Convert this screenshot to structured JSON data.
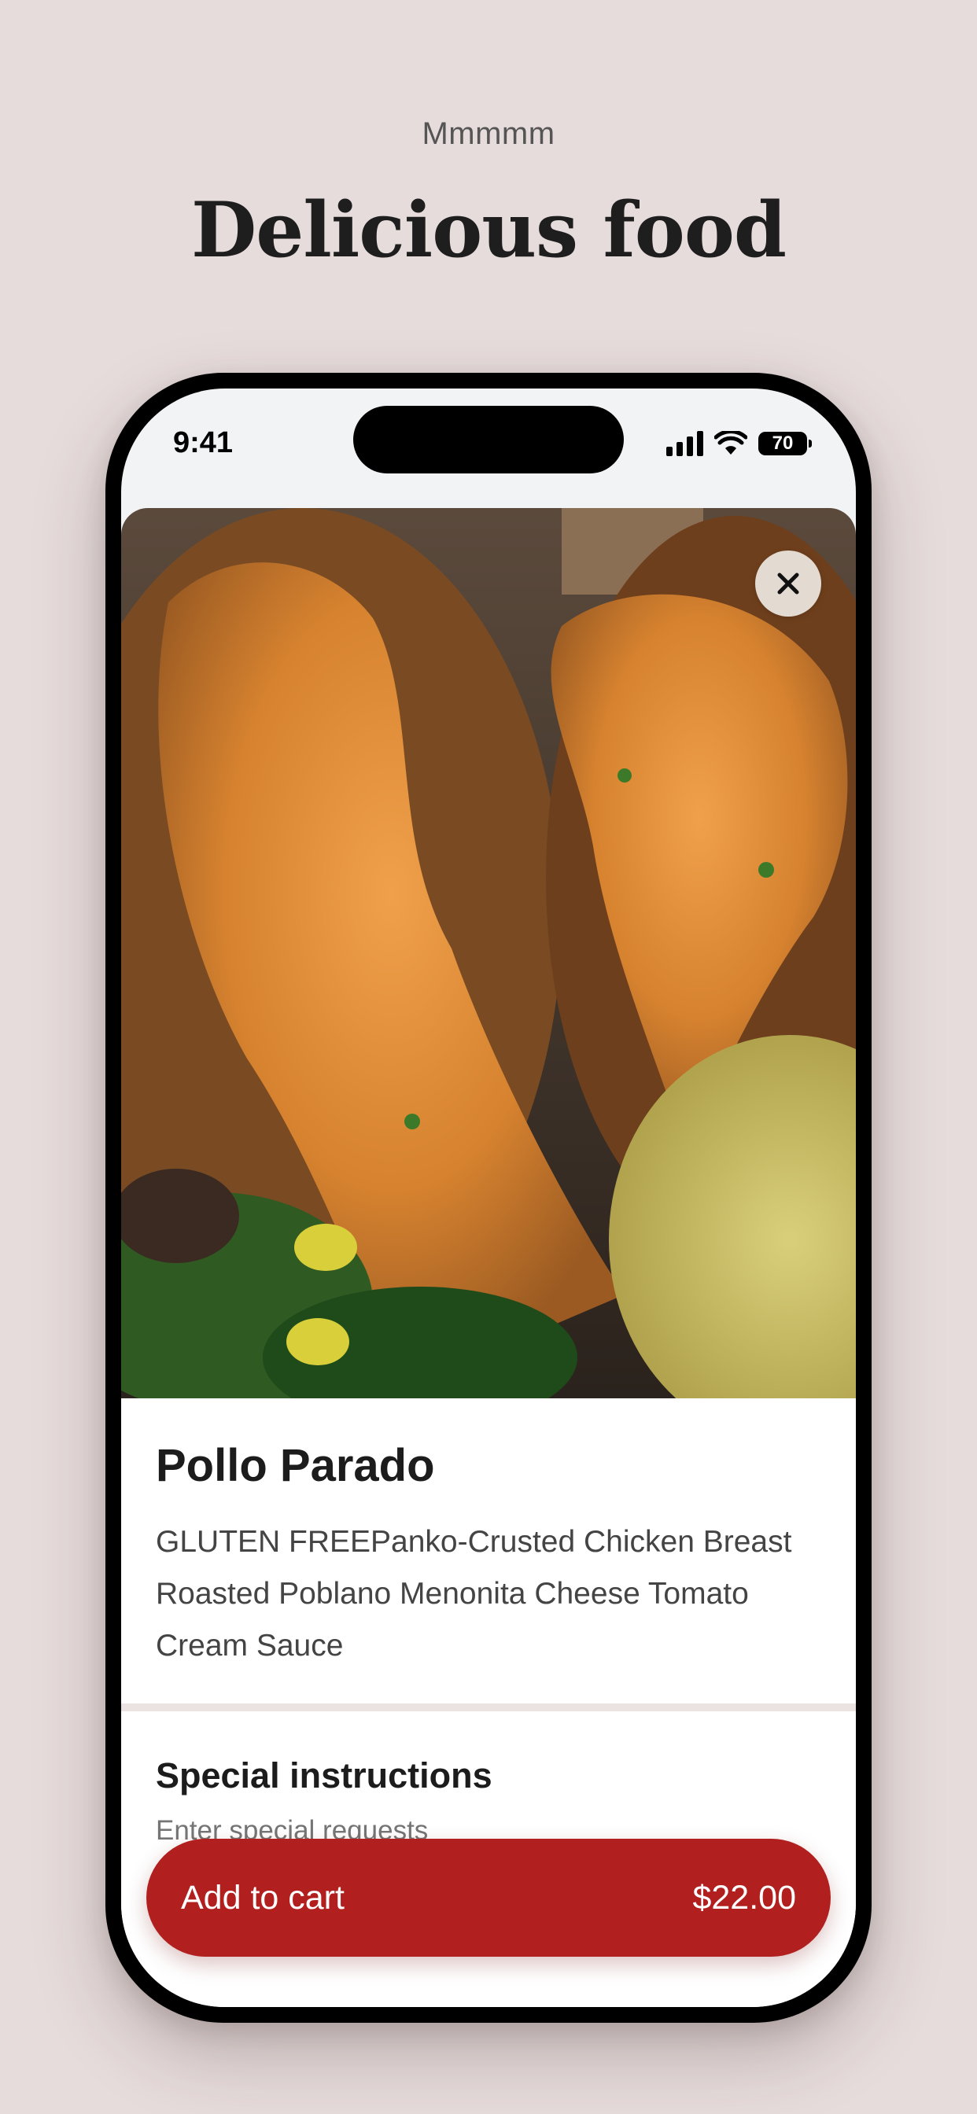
{
  "page": {
    "eyebrow": "Mmmmm",
    "headline": "Delicious food"
  },
  "status_bar": {
    "time": "9:41",
    "battery": "70"
  },
  "item": {
    "image_icon": "food-photo",
    "close_icon": "close-icon",
    "title": "Pollo Parado",
    "description": "GLUTEN FREEPanko-Crusted Chicken Breast Roasted Poblano Menonita Cheese Tomato Cream Sauce"
  },
  "special_instructions": {
    "title": "Special instructions",
    "placeholder": "Enter special requests"
  },
  "cart": {
    "label": "Add to cart",
    "price": "$22.00"
  },
  "colors": {
    "page_background": "#e6dcdb",
    "accent_red": "#b1201f"
  }
}
